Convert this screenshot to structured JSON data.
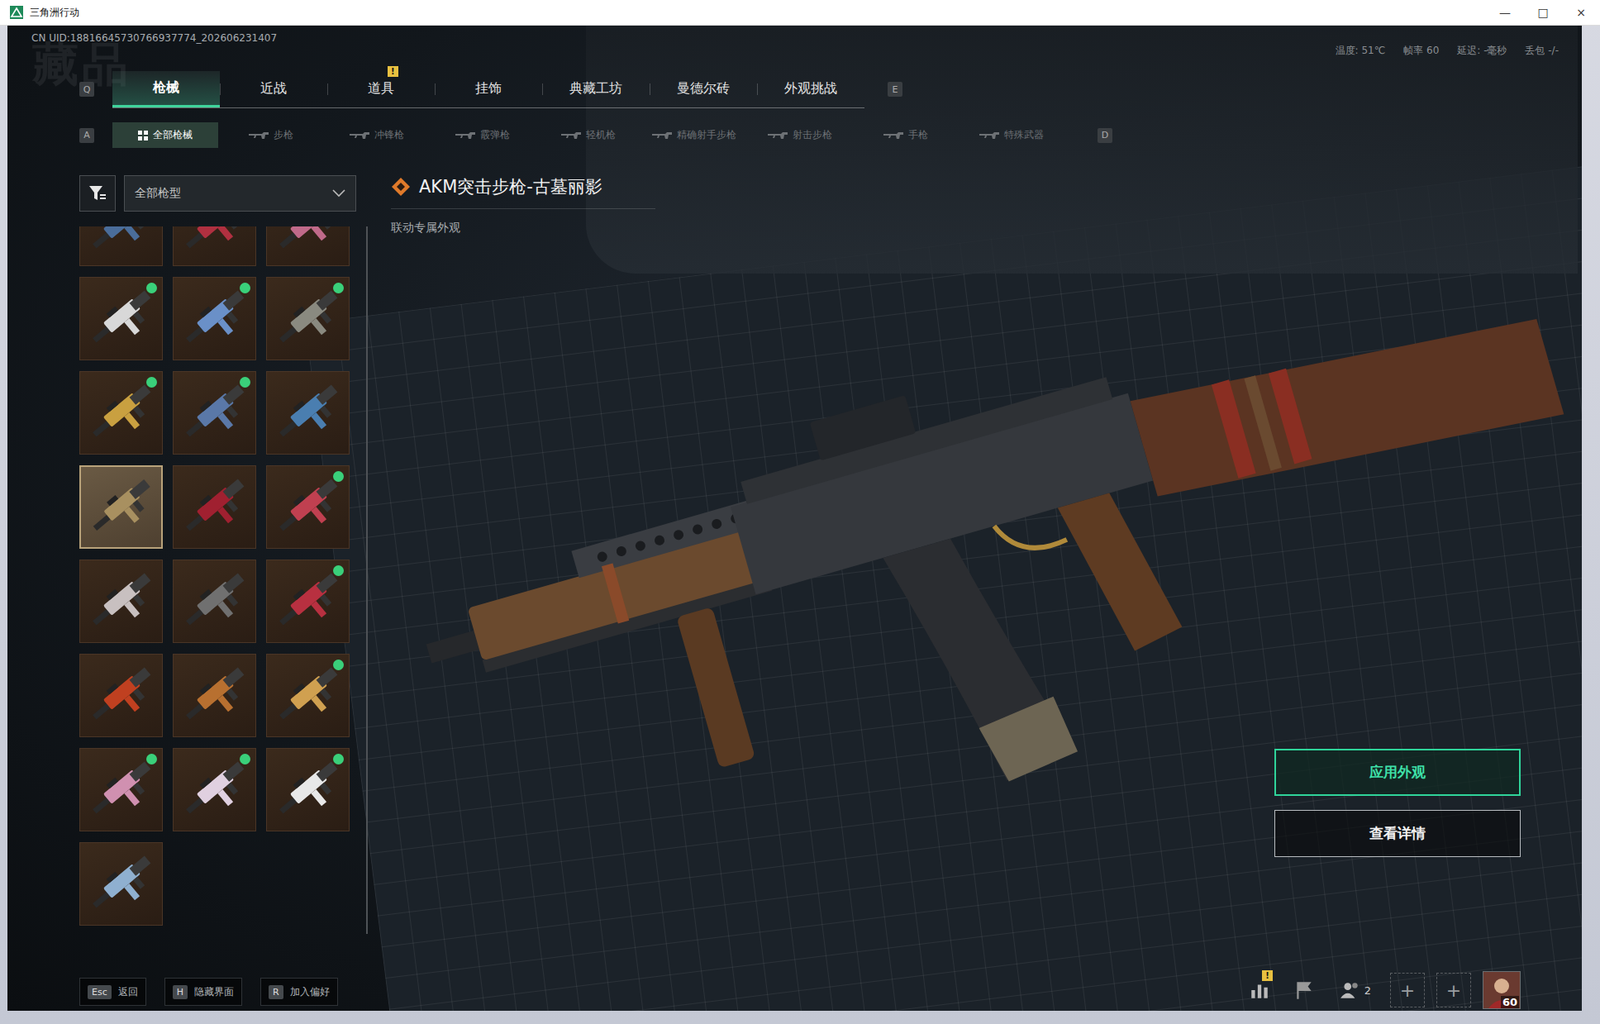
{
  "window": {
    "title": "三角洲行动",
    "controls": [
      "—",
      "□",
      "×"
    ]
  },
  "hud": {
    "uid": "CN UID:18816645730766937774_202606231407",
    "stats": [
      "温度: 51℃",
      "帧率 60",
      "延迟: -毫秒",
      "丢包 -/-"
    ]
  },
  "watermark": "藏品",
  "tabs": {
    "prev_key": "Q",
    "next_key": "E",
    "items": [
      {
        "label": "枪械",
        "selected": true,
        "badge": ""
      },
      {
        "label": "近战",
        "selected": false,
        "badge": ""
      },
      {
        "label": "道具",
        "selected": false,
        "badge": "!"
      },
      {
        "label": "挂饰",
        "selected": false,
        "badge": ""
      },
      {
        "label": "典藏工坊",
        "selected": false,
        "badge": ""
      },
      {
        "label": "曼德尔砖",
        "selected": false,
        "badge": ""
      },
      {
        "label": "外观挑战",
        "selected": false,
        "badge": ""
      }
    ]
  },
  "subtabs": {
    "prev_key": "A",
    "next_key": "D",
    "items": [
      {
        "label": "全部枪械",
        "selected": true
      },
      {
        "label": "步枪",
        "selected": false
      },
      {
        "label": "冲锋枪",
        "selected": false
      },
      {
        "label": "霰弹枪",
        "selected": false
      },
      {
        "label": "轻机枪",
        "selected": false
      },
      {
        "label": "精确射手步枪",
        "selected": false
      },
      {
        "label": "射击步枪",
        "selected": false
      },
      {
        "label": "手枪",
        "selected": false
      },
      {
        "label": "特殊武器",
        "selected": false
      }
    ]
  },
  "filter": {
    "value": "全部枪型"
  },
  "skins": [
    {
      "new": false,
      "selected": false,
      "color": "#4a6d9a"
    },
    {
      "new": false,
      "selected": false,
      "color": "#b03040"
    },
    {
      "new": false,
      "selected": false,
      "color": "#c06a8a"
    },
    {
      "new": true,
      "selected": false,
      "color": "#d8d8d8"
    },
    {
      "new": true,
      "selected": false,
      "color": "#6a90c8"
    },
    {
      "new": true,
      "selected": false,
      "color": "#8a8a80"
    },
    {
      "new": true,
      "selected": false,
      "color": "#c9a040"
    },
    {
      "new": true,
      "selected": false,
      "color": "#5a78a8"
    },
    {
      "new": false,
      "selected": false,
      "color": "#4a7eb0"
    },
    {
      "new": false,
      "selected": true,
      "color": "#a89060"
    },
    {
      "new": false,
      "selected": false,
      "color": "#a02030"
    },
    {
      "new": true,
      "selected": false,
      "color": "#c04050"
    },
    {
      "new": false,
      "selected": false,
      "color": "#c8c0c0"
    },
    {
      "new": false,
      "selected": false,
      "color": "#707070"
    },
    {
      "new": true,
      "selected": false,
      "color": "#b83040"
    },
    {
      "new": false,
      "selected": false,
      "color": "#c04020"
    },
    {
      "new": false,
      "selected": false,
      "color": "#b87030"
    },
    {
      "new": true,
      "selected": false,
      "color": "#d0a050"
    },
    {
      "new": true,
      "selected": false,
      "color": "#d090b0"
    },
    {
      "new": true,
      "selected": false,
      "color": "#e0d0e0"
    },
    {
      "new": true,
      "selected": false,
      "color": "#e8e8e8"
    },
    {
      "new": false,
      "selected": false,
      "color": "#8fb0d0"
    }
  ],
  "weapon": {
    "name": "AKM突击步枪-古墓丽影",
    "tag": "联动专属外观"
  },
  "buttons": [
    {
      "label": "应用外观",
      "primary": true
    },
    {
      "label": "查看详情",
      "primary": false
    }
  ],
  "hints": [
    {
      "key": "Esc",
      "label": "返回"
    },
    {
      "key": "H",
      "label": "隐藏界面"
    },
    {
      "key": "R",
      "label": "加入偏好"
    }
  ],
  "dock": {
    "stats_badge": "!",
    "friends": "2",
    "slots": [
      "+",
      "+"
    ],
    "level": "60"
  }
}
